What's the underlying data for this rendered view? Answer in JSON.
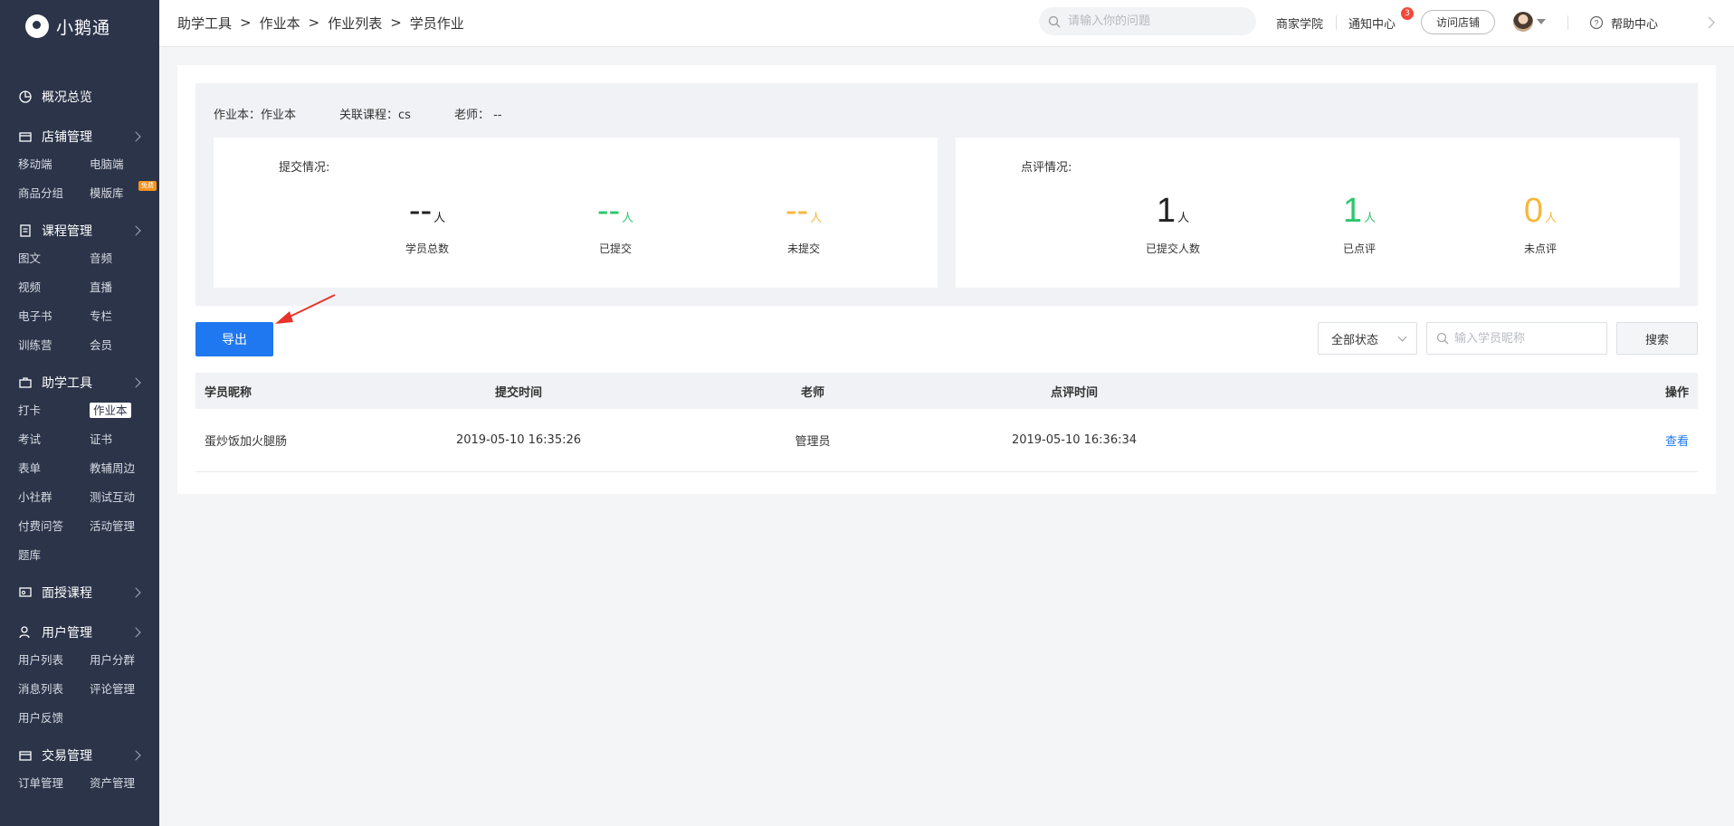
{
  "app": {
    "name": "小鹅通"
  },
  "sidebar": {
    "groups": [
      {
        "label": "概况总览",
        "icon": "pie-chart-icon",
        "items": []
      },
      {
        "label": "店铺管理",
        "icon": "store-icon",
        "items": [
          "移动端",
          "电脑端",
          "商品分组",
          "模版库"
        ],
        "new_badge": "免费"
      },
      {
        "label": "课程管理",
        "icon": "book-icon",
        "items": [
          "图文",
          "音频",
          "视频",
          "直播",
          "电子书",
          "专栏",
          "训练营",
          "会员"
        ]
      },
      {
        "label": "助学工具",
        "icon": "toolbox-icon",
        "items": [
          "打卡",
          "作业本",
          "考试",
          "证书",
          "表单",
          "教辅周边",
          "小社群",
          "测试互动",
          "付费问答",
          "活动管理",
          "题库"
        ],
        "active": "作业本"
      },
      {
        "label": "面授课程",
        "icon": "classroom-icon",
        "items": []
      },
      {
        "label": "用户管理",
        "icon": "user-icon",
        "items": [
          "用户列表",
          "用户分群",
          "消息列表",
          "评论管理",
          "用户反馈"
        ]
      },
      {
        "label": "交易管理",
        "icon": "card-icon",
        "items": [
          "订单管理",
          "资产管理"
        ]
      }
    ]
  },
  "header": {
    "breadcrumb": [
      "助学工具",
      "作业本",
      "作业列表",
      "学员作业"
    ],
    "search_placeholder": "请输入你的问题",
    "merchant_academy": "商家学院",
    "notifications": "通知中心",
    "notif_count": "3",
    "visit_store": "访问店铺",
    "help_center": "帮助中心"
  },
  "info": {
    "workbook": "作业本：作业本",
    "course": "关联课程：cs",
    "teacher": "老师： --"
  },
  "submission": {
    "title": "提交情况:",
    "stats": [
      {
        "value": "--",
        "unit": "人",
        "label": "学员总数",
        "color": "dark"
      },
      {
        "value": "--",
        "unit": "人",
        "label": "已提交",
        "color": "green"
      },
      {
        "value": "--",
        "unit": "人",
        "label": "未提交",
        "color": "orange"
      }
    ]
  },
  "review": {
    "title": "点评情况:",
    "stats": [
      {
        "value": "1",
        "unit": "人",
        "label": "已提交人数",
        "color": "dark"
      },
      {
        "value": "1",
        "unit": "人",
        "label": "已点评",
        "color": "green"
      },
      {
        "value": "0",
        "unit": "人",
        "label": "未点评",
        "color": "orange"
      }
    ]
  },
  "toolbar": {
    "export_label": "导出",
    "status_value": "全部状态",
    "name_placeholder": "输入学员昵称",
    "search_label": "搜索"
  },
  "table": {
    "columns": [
      "学员昵称",
      "提交时间",
      "老师",
      "点评时间",
      "操作"
    ],
    "rows": [
      {
        "nickname": "蛋炒饭加火腿肠",
        "submit_time": "2019-05-10 16:35:26",
        "teacher": "管理员",
        "review_time": "2019-05-10 16:36:34",
        "action": "查看"
      }
    ]
  },
  "colors": {
    "sidebar_bg": "#2b3449",
    "primary": "#1f78f0",
    "green": "#2ec76e",
    "orange": "#f6b73c",
    "badge_red": "#f5483b"
  }
}
